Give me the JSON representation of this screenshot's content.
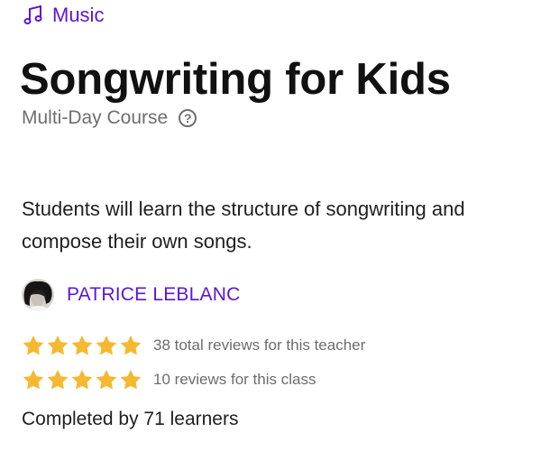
{
  "category": {
    "icon": "music-note-icon",
    "label": "Music",
    "color": "#5a16d6"
  },
  "course": {
    "title": "Songwriting for Kids",
    "type": "Multi-Day Course",
    "help_icon": "question-circle-icon",
    "description": "Students will learn the structure of songwriting and compose their own songs."
  },
  "teacher": {
    "name": "PATRICE LEBLANC"
  },
  "ratings": {
    "teacher": {
      "stars": 5,
      "text": "38 total reviews for this teacher"
    },
    "class": {
      "stars": 5,
      "text": "10 reviews for this class"
    },
    "star_color": "#f5b92f"
  },
  "completion": {
    "text": "Completed by 71 learners"
  }
}
